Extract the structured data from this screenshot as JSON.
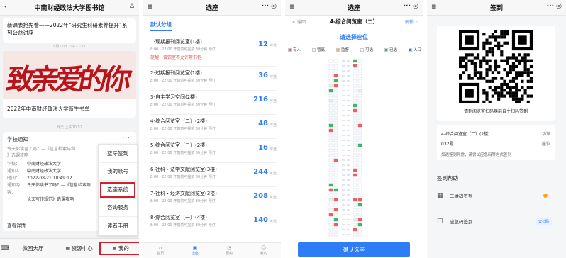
{
  "panel1": {
    "title": "中南财经政法大学图书馆",
    "user_icon": "person-icon",
    "top_text": "新课表抢先看——2022年“研究生科研素养提升”系列公益讲座！",
    "time1": "8月12日 下午17:52",
    "banner_text": "致亲爱的你",
    "banner_caption": "2022年中南财经政法大学新生书单",
    "time2": "昨天 上午10:52",
    "notice_title": "学校通知",
    "notice_sub1": "今天你读書了吗？—《信息检索与利",
    "notice_sub2": "》选课攻略",
    "rows": [
      {
        "k": "学校：",
        "v": "中南财经政法大学"
      },
      {
        "k": "通知人：",
        "v": "中南财经政法大学"
      },
      {
        "k": "时间：",
        "v": "2022-08-21 10:49:12"
      },
      {
        "k": "通知内容：",
        "v": "今天你读书了吗？—《信息检索与"
      },
      {
        "k": "",
        "v": "论文写作规范》选课攻略"
      }
    ],
    "notice_footer": "查看详情",
    "dots": "···",
    "popup": [
      "蓝牙签到",
      "我的账号",
      "选座系统",
      "咨询服务",
      "读者手册"
    ],
    "bottom": [
      "微回大厅",
      "≡ 资源中心",
      "",
      "≡ 我的"
    ]
  },
  "panel2": {
    "title": "选座",
    "left_icon": "≡",
    "right_icons": "··· ◎",
    "section": "默认分组",
    "rooms": [
      {
        "name": "1-现期报刊阅览室(1楼)",
        "hours": "8:00 - 22:00 开馆前可提前 30分钟 预订",
        "count": "12",
        "unit": "可选",
        "warn": "提醒：该馆室不允许带书包"
      },
      {
        "name": "2-过期报刊阅览室(1楼)",
        "hours": "8:00 - 22:00 开馆前可提前 30分钟 预订",
        "count": "36",
        "unit": "可选",
        "warn": ""
      },
      {
        "name": "3-自主学习空间(2楼)",
        "hours": "8:00 - 22:00 开馆前可提前 30分钟 预订",
        "count": "216",
        "unit": "可选",
        "warn": ""
      },
      {
        "name": "4-综合阅览室（二）(2楼)",
        "hours": "8:00 - 22:00 开馆前可提前 30分钟 预订",
        "count": "48",
        "unit": "可选",
        "warn": ""
      },
      {
        "name": "5-综合阅览室（三）(2楼)",
        "hours": "8:00 - 22:00 开馆前可提前 30分钟 预订",
        "count": "16",
        "unit": "可选",
        "warn": ""
      },
      {
        "name": "6-社科・法学文献阅览室(3楼)",
        "hours": "8:00 - 22:00 开馆前可提前 30分钟 预订",
        "count": "244",
        "unit": "可选",
        "warn": ""
      },
      {
        "name": "7-社科・经济文献阅览室(3楼)",
        "hours": "8:00 - 22:00 开馆前可提前 30分钟 预订",
        "count": "208",
        "unit": "可选",
        "warn": ""
      },
      {
        "name": "8-综合阅览室（一）(4楼)",
        "hours": "8:00 - 22:00 开馆前可提前 30分钟 预订",
        "count": "140",
        "unit": "可选",
        "warn": ""
      }
    ],
    "tabs": [
      {
        "icon": "⌂",
        "label": "首页",
        "active": false
      },
      {
        "icon": "▣",
        "label": "选座",
        "active": true
      },
      {
        "icon": "◔",
        "label": "预约",
        "active": false
      },
      {
        "icon": "☺",
        "label": "我的",
        "active": false
      }
    ]
  },
  "panel3": {
    "title": "选座",
    "back": "< 返回",
    "room_title": "4-综合阅览室（二）",
    "refresh": "刷新 ↻",
    "prompt": "请选择座位",
    "legend": [
      {
        "label": "有人",
        "color": "#e46262"
      },
      {
        "label": "暂离",
        "color": "#f0f0f0"
      },
      {
        "label": "监督",
        "color": "#e9b44c"
      },
      {
        "label": "可选",
        "color": "#ffffff"
      },
      {
        "label": "已选",
        "color": "#3fb56a"
      },
      {
        "label": "入口",
        "color": "#2f7df6"
      }
    ],
    "confirm": "确认选座"
  },
  "panel4": {
    "title": "签到",
    "qr_caption": "请到阅览室扫码器前自主扫码签到",
    "room_label": "4-综合阅览室（二）(2楼)",
    "room_value": "场馆",
    "seat_label": "032号",
    "seat_value": "座位",
    "note": "如遇签到异常，请尝试应急码等方式签到",
    "help_title": "签到帮助",
    "help_rows": [
      {
        "icon": "qr-code-icon",
        "glyph": "▦",
        "label": "二维码签到",
        "btn": ""
      },
      {
        "icon": "emergency-code-icon",
        "glyph": "◫",
        "label": "应急码签到",
        "btn": "去扫码"
      }
    ]
  }
}
